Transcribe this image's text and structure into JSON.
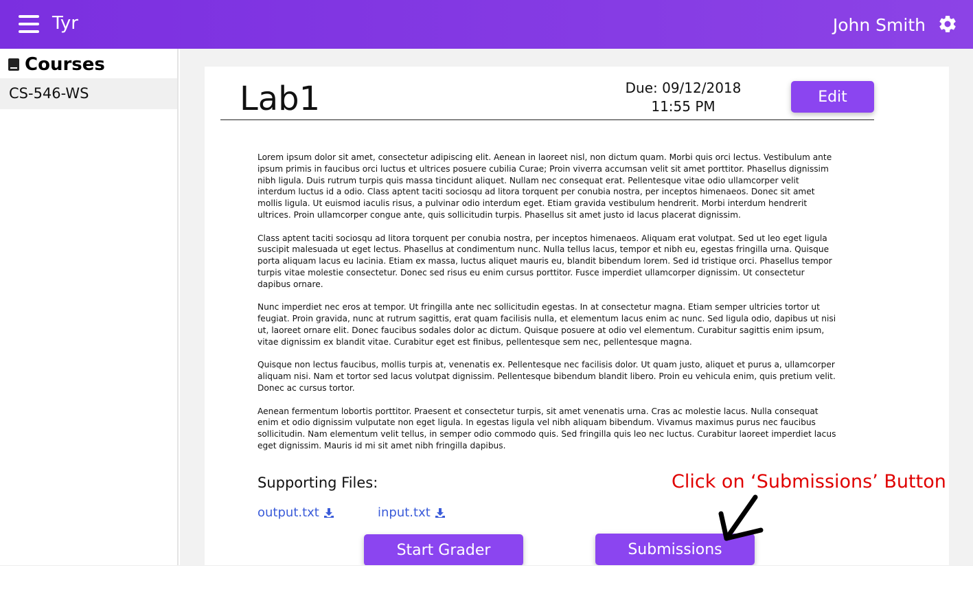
{
  "header": {
    "app_title": "Tyr",
    "user_name": "John Smith"
  },
  "sidebar": {
    "title": "Courses",
    "items": [
      {
        "label": "CS-546-WS"
      }
    ]
  },
  "assignment": {
    "title": "Lab1",
    "due_line1": "Due: 09/12/2018",
    "due_line2": "11:55 PM",
    "edit_label": "Edit",
    "paragraphs": [
      "Lorem ipsum dolor sit amet, consectetur adipiscing elit. Aenean in laoreet nisl, non dictum quam. Morbi quis orci lectus. Vestibulum ante ipsum primis in faucibus orci luctus et ultrices posuere cubilia Curae; Proin viverra accumsan velit sit amet porttitor. Phasellus dignissim nibh ligula. Duis rutrum turpis quis massa tincidunt aliquet. Nullam nec consequat erat. Pellentesque vitae odio ullamcorper velit interdum luctus id a odio. Class aptent taciti sociosqu ad litora torquent per conubia nostra, per inceptos himenaeos. Donec sit amet mollis ligula. Ut euismod iaculis risus, a pulvinar odio interdum eget. Etiam gravida vestibulum hendrerit. Morbi interdum hendrerit ultrices. Proin ullamcorper congue ante, quis sollicitudin turpis. Phasellus sit amet justo id lacus placerat dignissim.",
      "Class aptent taciti sociosqu ad litora torquent per conubia nostra, per inceptos himenaeos. Aliquam erat volutpat. Sed ut leo eget ligula suscipit malesuada ut eget lectus. Phasellus at condimentum nunc. Nulla tellus lacus, tempor et nibh eu, egestas fringilla urna. Quisque porta aliquam lacus eu lacinia. Etiam ex massa, luctus aliquet mauris eu, blandit bibendum lorem. Sed id tristique orci. Phasellus tempor turpis vitae molestie consectetur. Donec sed risus eu enim cursus porttitor. Fusce imperdiet ullamcorper dignissim. Ut consectetur dapibus ornare.",
      "Nunc imperdiet nec eros at tempor. Ut fringilla ante nec sollicitudin egestas. In at consectetur magna. Etiam semper ultricies tortor ut feugiat. Proin gravida, nunc at rutrum sagittis, erat quam facilisis nulla, et elementum lacus enim ac nunc. Sed ligula odio, dapibus ut nisi ut, laoreet ornare elit. Donec faucibus sodales dolor ac dictum. Quisque posuere at odio vel elementum. Curabitur sagittis enim ipsum, vitae dignissim ex blandit vitae. Curabitur eget est finibus, pellentesque sem nec, pellentesque magna.",
      "Quisque non lectus faucibus, mollis turpis at, venenatis ex. Pellentesque nec facilisis dolor. Ut quam justo, aliquet et purus a, ullamcorper aliquam nisi. Nam et tortor sed lacus volutpat dignissim. Pellentesque bibendum blandit libero. Proin eu vehicula enim, quis pretium velit. Donec ac cursus tortor.",
      "Aenean fermentum lobortis porttitor. Praesent et consectetur turpis, sit amet venenatis urna. Cras ac molestie lacus. Nulla consequat enim et odio dignissim vulputate non eget ligula. In egestas ligula vel nibh aliquam bibendum. Vivamus maximus purus nec faucibus sollicitudin. Nam elementum velit tellus, in semper odio commodo quis. Sed fringilla quis leo nec luctus. Curabitur laoreet imperdiet lacus eget dignissim. Mauris id mi sit amet nibh fringilla dapibus."
    ],
    "supporting_files_label": "Supporting Files:",
    "files": [
      {
        "name": "output.txt"
      },
      {
        "name": "input.txt"
      }
    ],
    "start_grader_label": "Start Grader",
    "submissions_label": "Submissions"
  },
  "annotation": {
    "text": "Click on ‘Submissions’ Button",
    "color": "#e00000"
  },
  "colors": {
    "topbar": "#7b2fe0",
    "button": "#8b45f0",
    "link": "#3a5bd9"
  },
  "icons": {
    "menu": "hamburger-icon",
    "settings": "gear-icon",
    "course": "book-icon",
    "download": "download-icon"
  }
}
